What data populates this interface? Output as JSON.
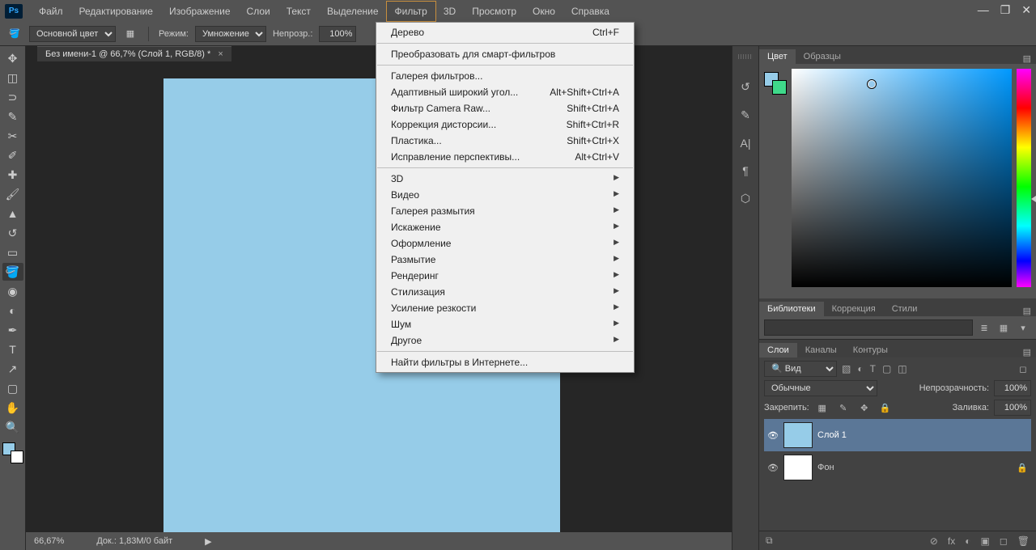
{
  "menubar": {
    "items": [
      "Файл",
      "Редактирование",
      "Изображение",
      "Слои",
      "Текст",
      "Выделение",
      "Фильтр",
      "3D",
      "Просмотр",
      "Окно",
      "Справка"
    ],
    "active_index": 6,
    "logo": "Ps"
  },
  "window_controls": {
    "min": "—",
    "restore": "❐",
    "close": "✕"
  },
  "options_bar": {
    "fg_label": "Основной цвет",
    "mode_label": "Режим:",
    "mode_value": "Умножение",
    "opacity_label": "Непрозр.:",
    "opacity_value": "100%"
  },
  "document": {
    "tab_title": "Без имени-1 @ 66,7% (Слой 1, RGB/8) *",
    "zoom": "66,67%",
    "doc_info": "Док.: 1,83M/0 байт",
    "canvas_color": "#96cce8"
  },
  "dropdown": {
    "groups": [
      {
        "items": [
          {
            "label": "Дерево",
            "shortcut": "Ctrl+F"
          }
        ]
      },
      {
        "items": [
          {
            "label": "Преобразовать для смарт-фильтров",
            "shortcut": ""
          }
        ]
      },
      {
        "items": [
          {
            "label": "Галерея фильтров...",
            "shortcut": ""
          },
          {
            "label": "Адаптивный широкий угол...",
            "shortcut": "Alt+Shift+Ctrl+A"
          },
          {
            "label": "Фильтр Camera Raw...",
            "shortcut": "Shift+Ctrl+A"
          },
          {
            "label": "Коррекция дисторсии...",
            "shortcut": "Shift+Ctrl+R"
          },
          {
            "label": "Пластика...",
            "shortcut": "Shift+Ctrl+X"
          },
          {
            "label": "Исправление перспективы...",
            "shortcut": "Alt+Ctrl+V"
          }
        ]
      },
      {
        "items": [
          {
            "label": "3D",
            "submenu": true
          },
          {
            "label": "Видео",
            "submenu": true
          },
          {
            "label": "Галерея размытия",
            "submenu": true
          },
          {
            "label": "Искажение",
            "submenu": true
          },
          {
            "label": "Оформление",
            "submenu": true
          },
          {
            "label": "Размытие",
            "submenu": true
          },
          {
            "label": "Рендеринг",
            "submenu": true
          },
          {
            "label": "Стилизация",
            "submenu": true
          },
          {
            "label": "Усиление резкости",
            "submenu": true
          },
          {
            "label": "Шум",
            "submenu": true
          },
          {
            "label": "Другое",
            "submenu": true
          }
        ]
      },
      {
        "items": [
          {
            "label": "Найти фильтры в Интернете...",
            "shortcut": ""
          }
        ]
      }
    ]
  },
  "tools": [
    {
      "name": "move-tool",
      "glyph": "✥"
    },
    {
      "name": "marquee-tool",
      "glyph": "◫"
    },
    {
      "name": "lasso-tool",
      "glyph": "⊃"
    },
    {
      "name": "quick-select-tool",
      "glyph": "✎"
    },
    {
      "name": "crop-tool",
      "glyph": "✂"
    },
    {
      "name": "eyedropper-tool",
      "glyph": "✐"
    },
    {
      "name": "healing-tool",
      "glyph": "✚"
    },
    {
      "name": "brush-tool",
      "glyph": "🖌"
    },
    {
      "name": "stamp-tool",
      "glyph": "▲"
    },
    {
      "name": "history-tool",
      "glyph": "↺"
    },
    {
      "name": "eraser-tool",
      "glyph": "▭"
    },
    {
      "name": "bucket-tool",
      "glyph": "🪣",
      "active": true
    },
    {
      "name": "blur-tool",
      "glyph": "◉"
    },
    {
      "name": "dodge-tool",
      "glyph": "◐"
    },
    {
      "name": "pen-tool",
      "glyph": "✒"
    },
    {
      "name": "type-tool",
      "glyph": "T"
    },
    {
      "name": "path-tool",
      "glyph": "↗"
    },
    {
      "name": "shape-tool",
      "glyph": "▢"
    },
    {
      "name": "hand-tool",
      "glyph": "✋"
    },
    {
      "name": "zoom-tool",
      "glyph": "🔍"
    }
  ],
  "mid_icons": [
    {
      "name": "history-icon",
      "glyph": "↺"
    },
    {
      "name": "properties-icon",
      "glyph": "✎"
    },
    {
      "name": "character-icon",
      "glyph": "A|"
    },
    {
      "name": "paragraph-icon",
      "glyph": "¶"
    },
    {
      "name": "3d-icon",
      "glyph": "⬡"
    }
  ],
  "color_panel": {
    "tabs": [
      "Цвет",
      "Образцы"
    ],
    "active_tab": 0,
    "fg": "#96cce8",
    "bg_swatch": "#3fd98a"
  },
  "lib_panel": {
    "tabs": [
      "Библиотеки",
      "Коррекция",
      "Стили"
    ],
    "active_tab": 0
  },
  "layers_panel": {
    "tabs": [
      "Слои",
      "Каналы",
      "Контуры"
    ],
    "active_tab": 0,
    "filter_kind": "Вид",
    "blend_mode": "Обычные",
    "opacity_label": "Непрозрачность:",
    "opacity_value": "100%",
    "lock_label": "Закрепить:",
    "fill_label": "Заливка:",
    "fill_value": "100%",
    "layers": [
      {
        "name": "Слой 1",
        "thumb": "#96cce8",
        "selected": true,
        "locked": false
      },
      {
        "name": "Фон",
        "thumb": "#ffffff",
        "selected": false,
        "locked": true
      }
    ],
    "footer_icons": [
      "⊘",
      "fx",
      "◐",
      "▣",
      "◻",
      "🗑"
    ]
  }
}
